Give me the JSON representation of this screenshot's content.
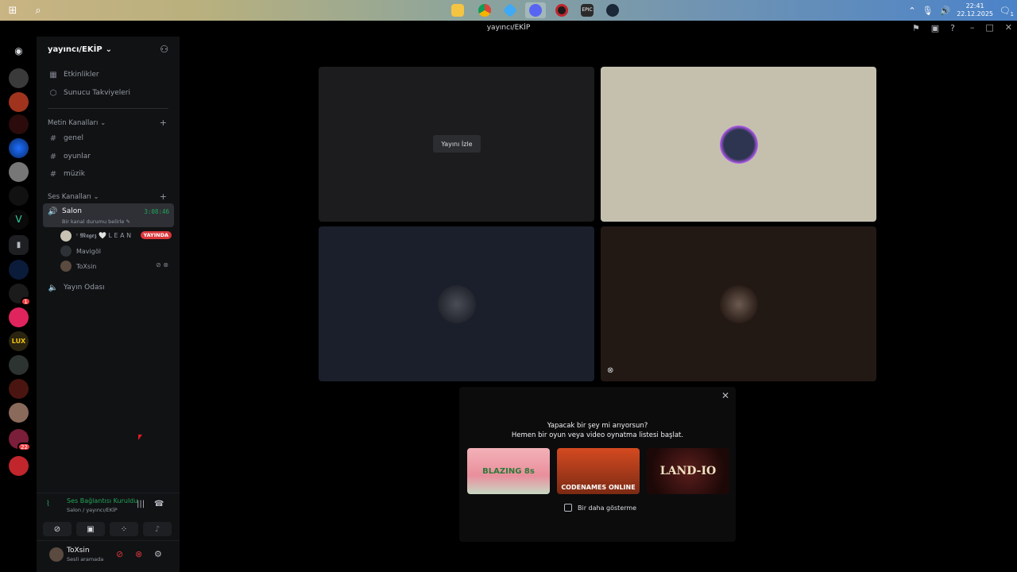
{
  "taskbar": {
    "clock_time": "22:41",
    "clock_date": "22.12.2025",
    "notification_count": "1",
    "apps": [
      "file-explorer",
      "chrome",
      "app-diamond",
      "discord",
      "app-red",
      "epic-games",
      "steam"
    ],
    "epic_label": "EPIC"
  },
  "window": {
    "title": "yayıncı/EKİP"
  },
  "server": {
    "name": "yayıncı/EKİP",
    "events_label": "Etkinlikler",
    "boosts_label": "Sunucu Takviyeleri"
  },
  "categories": {
    "text_label": "Metin Kanalları",
    "voice_label": "Ses Kanalları"
  },
  "text_channels": [
    "genel",
    "oyunlar",
    "müzik"
  ],
  "voice_channel": {
    "name": "Salon",
    "timer": "3:08:46",
    "status_placeholder": "Bir kanal durumu belirle",
    "users": [
      {
        "name": "ᶦ 𝕸𝖆𝖌𝖊𝖟 🤍 L E A N",
        "live_badge": "YAYINDA"
      },
      {
        "name": "Mavigöl"
      },
      {
        "name": "ToXsin"
      }
    ]
  },
  "other_voice_channel": "Yayın Odası",
  "rail_badges": {
    "server_badge_1": "1",
    "server_badge_22": "22"
  },
  "voice_panel": {
    "status": "Ses Bağlantısı Kuruldu",
    "location": "Salon / yayıncı/EKİP"
  },
  "user_panel": {
    "username": "ToXsin",
    "state": "Sesli aramada"
  },
  "stage": {
    "watch_label": "Yayını İzle"
  },
  "activity_popup": {
    "line1": "Yapacak bir şey mi arıyorsun?",
    "line2": "Hemen bir oyun veya video oynatma listesi başlat.",
    "games": [
      "BLAZING 8s",
      "CODENAMES ONLINE",
      "LAND-IO"
    ],
    "dont_show_label": "Bir daha gösterme"
  },
  "colors": {
    "accent_green": "#23a55a",
    "live_red": "#da373c",
    "sidebar_bg": "#111214"
  }
}
